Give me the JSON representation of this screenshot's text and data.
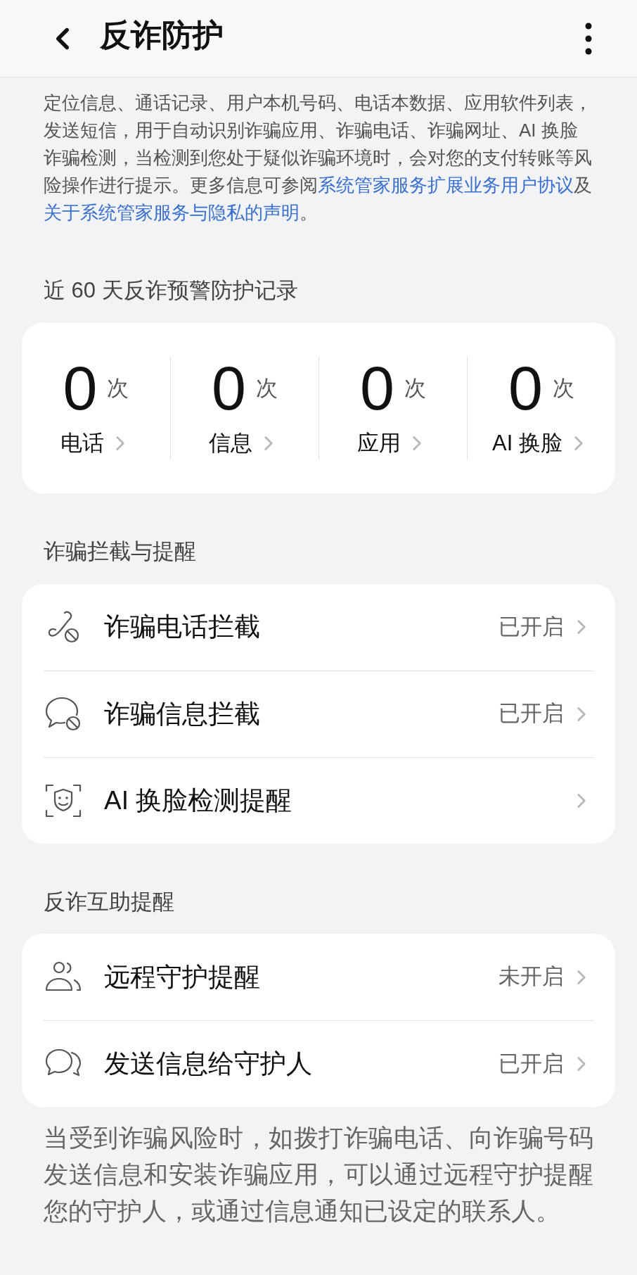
{
  "header": {
    "title": "反诈防护"
  },
  "intro": [
    {
      "kind": "text",
      "text": "定位信息、通话记录、用户本机号码、电话本数据、应用软件列表，发送短信，用于自动识别诈骗应用、诈骗电话、诈骗网址、AI 换脸诈骗检测，当检测到您处于疑似诈骗环境时，会对您的支付转账等风险操作进行提示。更多信息可参阅"
    },
    {
      "kind": "link",
      "text": "系统管家服务扩展业务用户协议"
    },
    {
      "kind": "text",
      "text": "及"
    },
    {
      "kind": "link",
      "text": "关于系统管家服务与隐私的声明"
    },
    {
      "kind": "text",
      "text": "。"
    }
  ],
  "records": {
    "heading": "近 60 天反诈预警防护记录",
    "stats": [
      {
        "count": "0",
        "unit": "次",
        "label": "电话"
      },
      {
        "count": "0",
        "unit": "次",
        "label": "信息"
      },
      {
        "count": "0",
        "unit": "次",
        "label": "应用"
      },
      {
        "count": "0",
        "unit": "次",
        "label": "AI 换脸"
      }
    ]
  },
  "sections": [
    {
      "heading": "诈骗拦截与提醒",
      "items": [
        {
          "kind": "phone",
          "label": "诈骗电话拦截",
          "status": "已开启"
        },
        {
          "kind": "message",
          "label": "诈骗信息拦截",
          "status": "已开启"
        },
        {
          "kind": "face",
          "label": "AI 换脸检测提醒"
        }
      ]
    },
    {
      "heading": "反诈互助提醒",
      "items": [
        {
          "kind": "guardian",
          "label": "远程守护提醒",
          "status": "未开启"
        },
        {
          "kind": "notify",
          "label": "发送信息给守护人",
          "status": "已开启"
        }
      ]
    }
  ],
  "footer": "当受到诈骗风险时，如拨打诈骗电话、向诈骗号码发送信息和安装诈骗应用，可以通过远程守护提醒您的守护人，或通过信息通知已设定的联系人。"
}
